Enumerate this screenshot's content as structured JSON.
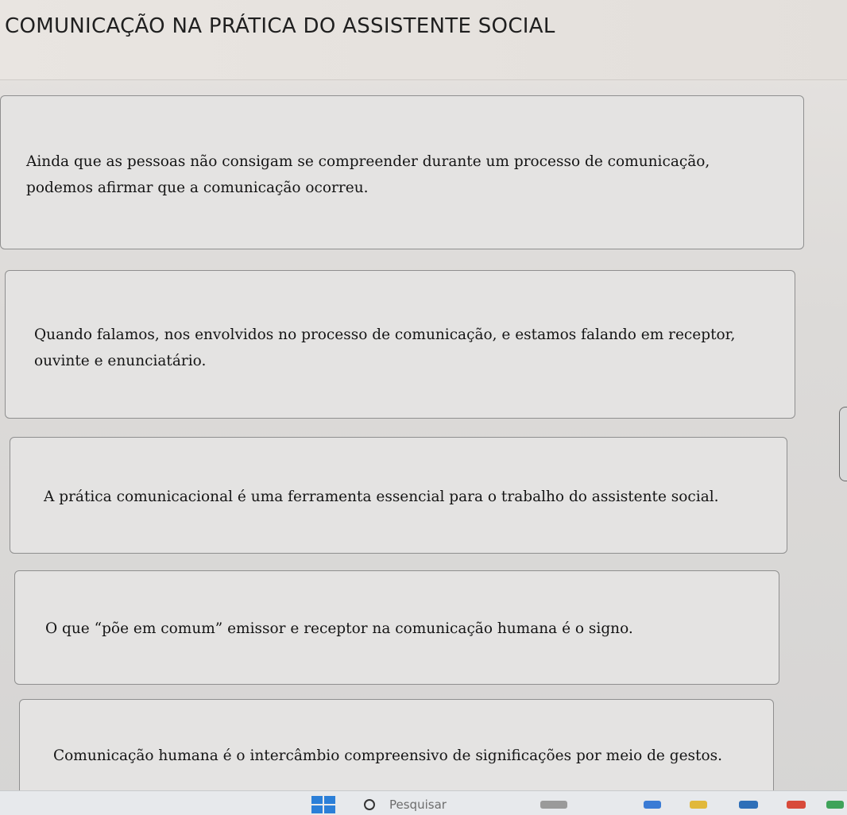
{
  "header": {
    "title": "COMUNICAÇÃO NA PRÁTICA DO ASSISTENTE SOCIAL"
  },
  "statements": [
    {
      "text": "Ainda que as pessoas não consigam se compreender durante um processo de comunicação, podemos afirmar que a comunicação ocorreu."
    },
    {
      "text": "Quando falamos, nos envolvidos no processo de comunicação, e estamos falando em receptor, ouvinte e enunciatário."
    },
    {
      "text": "A prática comunicacional é uma ferramenta essencial para o trabalho do assistente social."
    },
    {
      "text": "O que “põe em comum” emissor e receptor na comunicação humana é o signo."
    },
    {
      "text": "Comunicação humana é o intercâmbio compreensivo de significações por meio de gestos."
    }
  ],
  "taskbar": {
    "search_label": "Pesquisar",
    "start_icon": "windows-start-icon",
    "search_icon": "search-icon"
  }
}
